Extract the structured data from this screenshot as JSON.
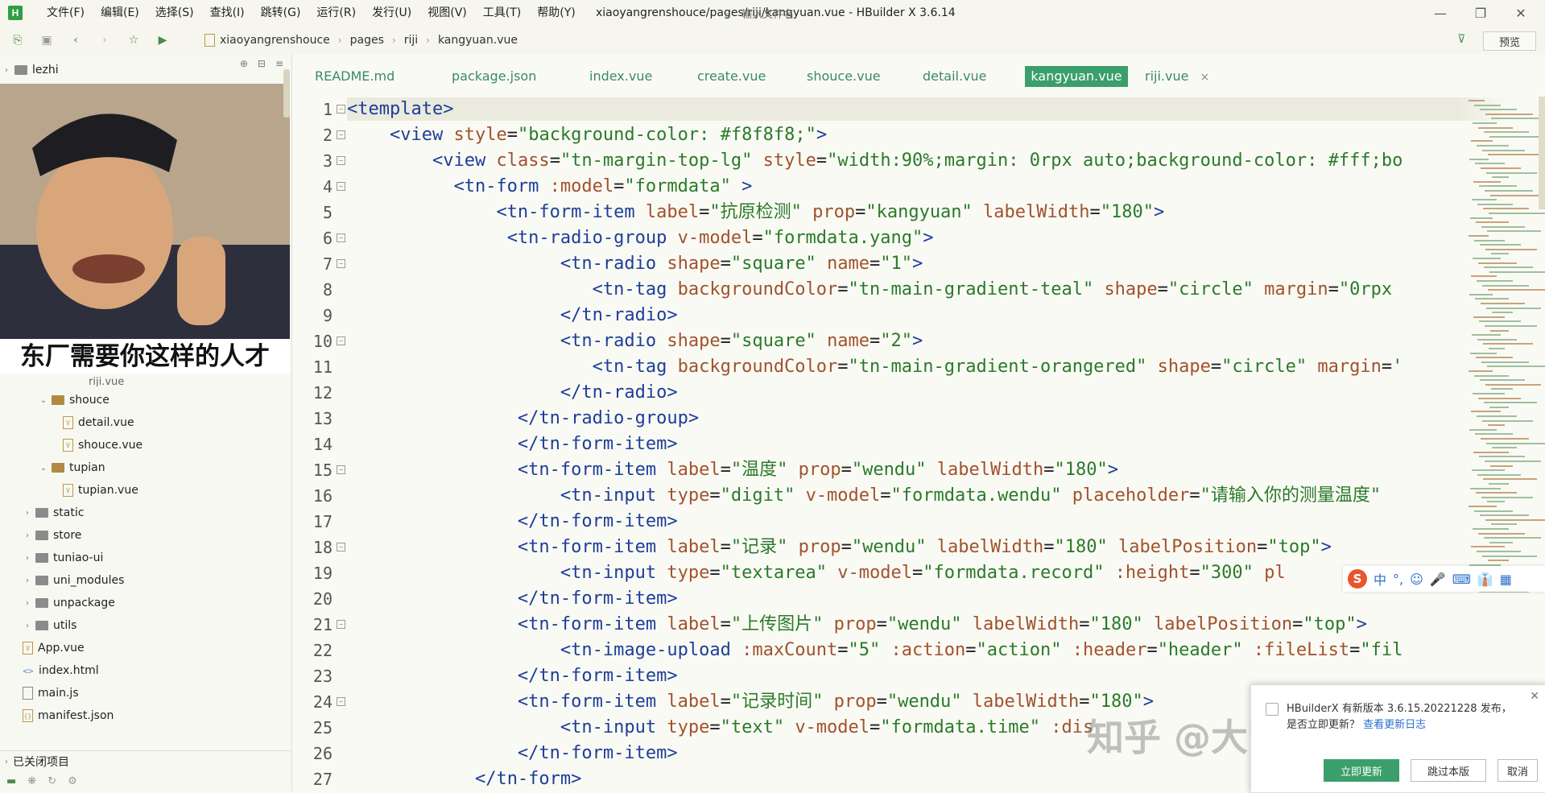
{
  "app": {
    "logo": "H",
    "window_title": "xiaoyangrenshouce/pages/riji/kangyuan.vue - HBuilder X 3.6.14",
    "menu": [
      "文件(F)",
      "编辑(E)",
      "选择(S)",
      "查找(I)",
      "跳转(G)",
      "运行(R)",
      "发行(U)",
      "视图(V)",
      "工具(T)",
      "帮助(Y)"
    ]
  },
  "toolbar": {
    "breadcrumb": [
      "xiaoyangrenshouce",
      "pages",
      "riji",
      "kangyuan.vue"
    ],
    "file_search_placeholder": "输入文件名",
    "preview_label": "预览"
  },
  "sidebar": {
    "root_project": "lezhi",
    "meme_caption": "东厂需要你这样的人才",
    "partial_item": "riji.vue",
    "tree": [
      {
        "label": "shouce",
        "type": "folder-open",
        "level": 2
      },
      {
        "label": "detail.vue",
        "type": "vue",
        "level": 3
      },
      {
        "label": "shouce.vue",
        "type": "vue",
        "level": 3
      },
      {
        "label": "tupian",
        "type": "folder-open",
        "level": 2
      },
      {
        "label": "tupian.vue",
        "type": "vue",
        "level": 3
      },
      {
        "label": "static",
        "type": "folder",
        "level": 1
      },
      {
        "label": "store",
        "type": "folder",
        "level": 1
      },
      {
        "label": "tuniao-ui",
        "type": "folder",
        "level": 1
      },
      {
        "label": "uni_modules",
        "type": "folder",
        "level": 1
      },
      {
        "label": "unpackage",
        "type": "folder",
        "level": 1
      },
      {
        "label": "utils",
        "type": "folder",
        "level": 1
      },
      {
        "label": "App.vue",
        "type": "vue",
        "level": 1
      },
      {
        "label": "index.html",
        "type": "html",
        "level": 1
      },
      {
        "label": "main.js",
        "type": "js",
        "level": 1
      },
      {
        "label": "manifest.json",
        "type": "json",
        "level": 1
      }
    ],
    "closed_projects": "已关闭项目"
  },
  "tabs": [
    {
      "label": "README.md"
    },
    {
      "label": "package.json"
    },
    {
      "label": "index.vue"
    },
    {
      "label": "create.vue"
    },
    {
      "label": "shouce.vue"
    },
    {
      "label": "detail.vue"
    },
    {
      "label": "kangyuan.vue",
      "active": true
    },
    {
      "label": "riji.vue"
    }
  ],
  "code_lines": [
    {
      "n": "1",
      "fold": true,
      "tokens": [
        [
          "t",
          "<template>"
        ]
      ]
    },
    {
      "n": "2",
      "fold": true,
      "tokens": [
        [
          "p",
          "    "
        ],
        [
          "t",
          "<view "
        ],
        [
          "a",
          "style"
        ],
        [
          "p",
          "="
        ],
        [
          "s",
          "\"background-color: #f8f8f8;\""
        ],
        [
          "t",
          ">"
        ]
      ]
    },
    {
      "n": "3",
      "fold": true,
      "tokens": [
        [
          "p",
          "        "
        ],
        [
          "t",
          "<view "
        ],
        [
          "a",
          "class"
        ],
        [
          "p",
          "="
        ],
        [
          "s",
          "\"tn-margin-top-lg\" "
        ],
        [
          "a",
          "style"
        ],
        [
          "p",
          "="
        ],
        [
          "s",
          "\"width:90%;margin: 0rpx auto;background-color: #fff;bo"
        ]
      ]
    },
    {
      "n": "4",
      "fold": true,
      "tokens": [
        [
          "p",
          "          "
        ],
        [
          "t",
          "<tn-form "
        ],
        [
          "a",
          ":model"
        ],
        [
          "p",
          "="
        ],
        [
          "s",
          "\"formdata\" "
        ],
        [
          "t",
          ">"
        ]
      ]
    },
    {
      "n": "5",
      "fold": false,
      "tokens": [
        [
          "p",
          "              "
        ],
        [
          "t",
          "<tn-form-item "
        ],
        [
          "a",
          "label"
        ],
        [
          "p",
          "="
        ],
        [
          "s",
          "\"抗原检测\" "
        ],
        [
          "a",
          "prop"
        ],
        [
          "p",
          "="
        ],
        [
          "s",
          "\"kangyuan\" "
        ],
        [
          "a",
          "labelWidth"
        ],
        [
          "p",
          "="
        ],
        [
          "s",
          "\"180\""
        ],
        [
          "t",
          ">"
        ]
      ]
    },
    {
      "n": "6",
      "fold": true,
      "tokens": [
        [
          "p",
          "               "
        ],
        [
          "t",
          "<tn-radio-group "
        ],
        [
          "a",
          "v-model"
        ],
        [
          "p",
          "="
        ],
        [
          "s",
          "\"formdata.yang\""
        ],
        [
          "t",
          ">"
        ]
      ]
    },
    {
      "n": "7",
      "fold": true,
      "tokens": [
        [
          "p",
          "                    "
        ],
        [
          "t",
          "<tn-radio "
        ],
        [
          "a",
          "shape"
        ],
        [
          "p",
          "="
        ],
        [
          "s",
          "\"square\" "
        ],
        [
          "a",
          "name"
        ],
        [
          "p",
          "="
        ],
        [
          "s",
          "\"1\""
        ],
        [
          "t",
          ">"
        ]
      ]
    },
    {
      "n": "8",
      "fold": false,
      "tokens": [
        [
          "p",
          "                       "
        ],
        [
          "t",
          "<tn-tag "
        ],
        [
          "a",
          "backgroundColor"
        ],
        [
          "p",
          "="
        ],
        [
          "s",
          "\"tn-main-gradient-teal\" "
        ],
        [
          "a",
          "shape"
        ],
        [
          "p",
          "="
        ],
        [
          "s",
          "\"circle\" "
        ],
        [
          "a",
          "margin"
        ],
        [
          "p",
          "="
        ],
        [
          "s",
          "\"0rpx"
        ]
      ]
    },
    {
      "n": "9",
      "fold": false,
      "tokens": [
        [
          "p",
          "                    "
        ],
        [
          "t",
          "</tn-radio>"
        ]
      ]
    },
    {
      "n": "10",
      "fold": true,
      "tokens": [
        [
          "p",
          "                    "
        ],
        [
          "t",
          "<tn-radio "
        ],
        [
          "a",
          "shape"
        ],
        [
          "p",
          "="
        ],
        [
          "s",
          "\"square\" "
        ],
        [
          "a",
          "name"
        ],
        [
          "p",
          "="
        ],
        [
          "s",
          "\"2\""
        ],
        [
          "t",
          ">"
        ]
      ]
    },
    {
      "n": "11",
      "fold": false,
      "tokens": [
        [
          "p",
          "                       "
        ],
        [
          "t",
          "<tn-tag "
        ],
        [
          "a",
          "backgroundColor"
        ],
        [
          "p",
          "="
        ],
        [
          "s",
          "\"tn-main-gradient-orangered\" "
        ],
        [
          "a",
          "shape"
        ],
        [
          "p",
          "="
        ],
        [
          "s",
          "\"circle\" "
        ],
        [
          "a",
          "margin"
        ],
        [
          "p",
          "="
        ],
        [
          "s",
          "'"
        ]
      ]
    },
    {
      "n": "12",
      "fold": false,
      "tokens": [
        [
          "p",
          "                    "
        ],
        [
          "t",
          "</tn-radio>"
        ]
      ]
    },
    {
      "n": "13",
      "fold": false,
      "tokens": [
        [
          "p",
          "                "
        ],
        [
          "t",
          "</tn-radio-group>"
        ]
      ]
    },
    {
      "n": "14",
      "fold": false,
      "tokens": [
        [
          "p",
          "                "
        ],
        [
          "t",
          "</tn-form-item>"
        ]
      ]
    },
    {
      "n": "15",
      "fold": true,
      "tokens": [
        [
          "p",
          "                "
        ],
        [
          "t",
          "<tn-form-item "
        ],
        [
          "a",
          "label"
        ],
        [
          "p",
          "="
        ],
        [
          "s",
          "\"温度\" "
        ],
        [
          "a",
          "prop"
        ],
        [
          "p",
          "="
        ],
        [
          "s",
          "\"wendu\" "
        ],
        [
          "a",
          "labelWidth"
        ],
        [
          "p",
          "="
        ],
        [
          "s",
          "\"180\""
        ],
        [
          "t",
          ">"
        ]
      ]
    },
    {
      "n": "16",
      "fold": false,
      "tokens": [
        [
          "p",
          "                    "
        ],
        [
          "t",
          "<tn-input "
        ],
        [
          "a",
          "type"
        ],
        [
          "p",
          "="
        ],
        [
          "s",
          "\"digit\" "
        ],
        [
          "a",
          "v-model"
        ],
        [
          "p",
          "="
        ],
        [
          "s",
          "\"formdata.wendu\" "
        ],
        [
          "a",
          "placeholder"
        ],
        [
          "p",
          "="
        ],
        [
          "s",
          "\"请输入你的测量温度\""
        ]
      ]
    },
    {
      "n": "17",
      "fold": false,
      "tokens": [
        [
          "p",
          "                "
        ],
        [
          "t",
          "</tn-form-item>"
        ]
      ]
    },
    {
      "n": "18",
      "fold": true,
      "tokens": [
        [
          "p",
          "                "
        ],
        [
          "t",
          "<tn-form-item "
        ],
        [
          "a",
          "label"
        ],
        [
          "p",
          "="
        ],
        [
          "s",
          "\"记录\" "
        ],
        [
          "a",
          "prop"
        ],
        [
          "p",
          "="
        ],
        [
          "s",
          "\"wendu\" "
        ],
        [
          "a",
          "labelWidth"
        ],
        [
          "p",
          "="
        ],
        [
          "s",
          "\"180\" "
        ],
        [
          "a",
          "labelPosition"
        ],
        [
          "p",
          "="
        ],
        [
          "s",
          "\"top\""
        ],
        [
          "t",
          ">"
        ]
      ]
    },
    {
      "n": "19",
      "fold": false,
      "tokens": [
        [
          "p",
          "                    "
        ],
        [
          "t",
          "<tn-input "
        ],
        [
          "a",
          "type"
        ],
        [
          "p",
          "="
        ],
        [
          "s",
          "\"textarea\" "
        ],
        [
          "a",
          "v-model"
        ],
        [
          "p",
          "="
        ],
        [
          "s",
          "\"formdata.record\" "
        ],
        [
          "a",
          ":height"
        ],
        [
          "p",
          "="
        ],
        [
          "s",
          "\"300\" "
        ],
        [
          "a",
          "pl"
        ]
      ]
    },
    {
      "n": "20",
      "fold": false,
      "tokens": [
        [
          "p",
          "                "
        ],
        [
          "t",
          "</tn-form-item>"
        ]
      ]
    },
    {
      "n": "21",
      "fold": true,
      "tokens": [
        [
          "p",
          "                "
        ],
        [
          "t",
          "<tn-form-item "
        ],
        [
          "a",
          "label"
        ],
        [
          "p",
          "="
        ],
        [
          "s",
          "\"上传图片\" "
        ],
        [
          "a",
          "prop"
        ],
        [
          "p",
          "="
        ],
        [
          "s",
          "\"wendu\" "
        ],
        [
          "a",
          "labelWidth"
        ],
        [
          "p",
          "="
        ],
        [
          "s",
          "\"180\" "
        ],
        [
          "a",
          "labelPosition"
        ],
        [
          "p",
          "="
        ],
        [
          "s",
          "\"top\""
        ],
        [
          "t",
          ">"
        ]
      ]
    },
    {
      "n": "22",
      "fold": false,
      "tokens": [
        [
          "p",
          "                    "
        ],
        [
          "t",
          "<tn-image-upload "
        ],
        [
          "a",
          ":maxCount"
        ],
        [
          "p",
          "="
        ],
        [
          "s",
          "\"5\" "
        ],
        [
          "a",
          ":action"
        ],
        [
          "p",
          "="
        ],
        [
          "s",
          "\"action\" "
        ],
        [
          "a",
          ":header"
        ],
        [
          "p",
          "="
        ],
        [
          "s",
          "\"header\" "
        ],
        [
          "a",
          ":fileList"
        ],
        [
          "p",
          "="
        ],
        [
          "s",
          "\"fil"
        ]
      ]
    },
    {
      "n": "23",
      "fold": false,
      "tokens": [
        [
          "p",
          "                "
        ],
        [
          "t",
          "</tn-form-item>"
        ]
      ]
    },
    {
      "n": "24",
      "fold": true,
      "tokens": [
        [
          "p",
          "                "
        ],
        [
          "t",
          "<tn-form-item "
        ],
        [
          "a",
          "label"
        ],
        [
          "p",
          "="
        ],
        [
          "s",
          "\"记录时间\" "
        ],
        [
          "a",
          "prop"
        ],
        [
          "p",
          "="
        ],
        [
          "s",
          "\"wendu\" "
        ],
        [
          "a",
          "labelWidth"
        ],
        [
          "p",
          "="
        ],
        [
          "s",
          "\"180\""
        ],
        [
          "t",
          ">"
        ]
      ]
    },
    {
      "n": "25",
      "fold": false,
      "tokens": [
        [
          "p",
          "                    "
        ],
        [
          "t",
          "<tn-input "
        ],
        [
          "a",
          "type"
        ],
        [
          "p",
          "="
        ],
        [
          "s",
          "\"text\" "
        ],
        [
          "a",
          "v-model"
        ],
        [
          "p",
          "="
        ],
        [
          "s",
          "\"formdata.time\" "
        ],
        [
          "a",
          ":dis"
        ]
      ]
    },
    {
      "n": "26",
      "fold": false,
      "tokens": [
        [
          "p",
          "                "
        ],
        [
          "t",
          "</tn-form-item>"
        ]
      ]
    },
    {
      "n": "27",
      "fold": false,
      "tokens": [
        [
          "p",
          "            "
        ],
        [
          "t",
          "</tn-form>"
        ]
      ]
    }
  ],
  "ime": {
    "logo": "S",
    "items": [
      "中",
      "°,",
      "☺",
      "🎤",
      "⌨",
      "👔",
      "▦"
    ]
  },
  "update_popup": {
    "message": "HBuilderX 有新版本 3.6.15.20221228 发布，是否立即更新？",
    "link": "查看更新日志",
    "update_now": "立即更新",
    "skip_version": "跳过本版",
    "cancel": "取消"
  },
  "watermark": "知乎 @大雪纯有标签",
  "colors": {
    "accent": "#3a9f6a",
    "tag": "#1c3e9a",
    "attr": "#a0522d",
    "string": "#2a7a2a"
  }
}
